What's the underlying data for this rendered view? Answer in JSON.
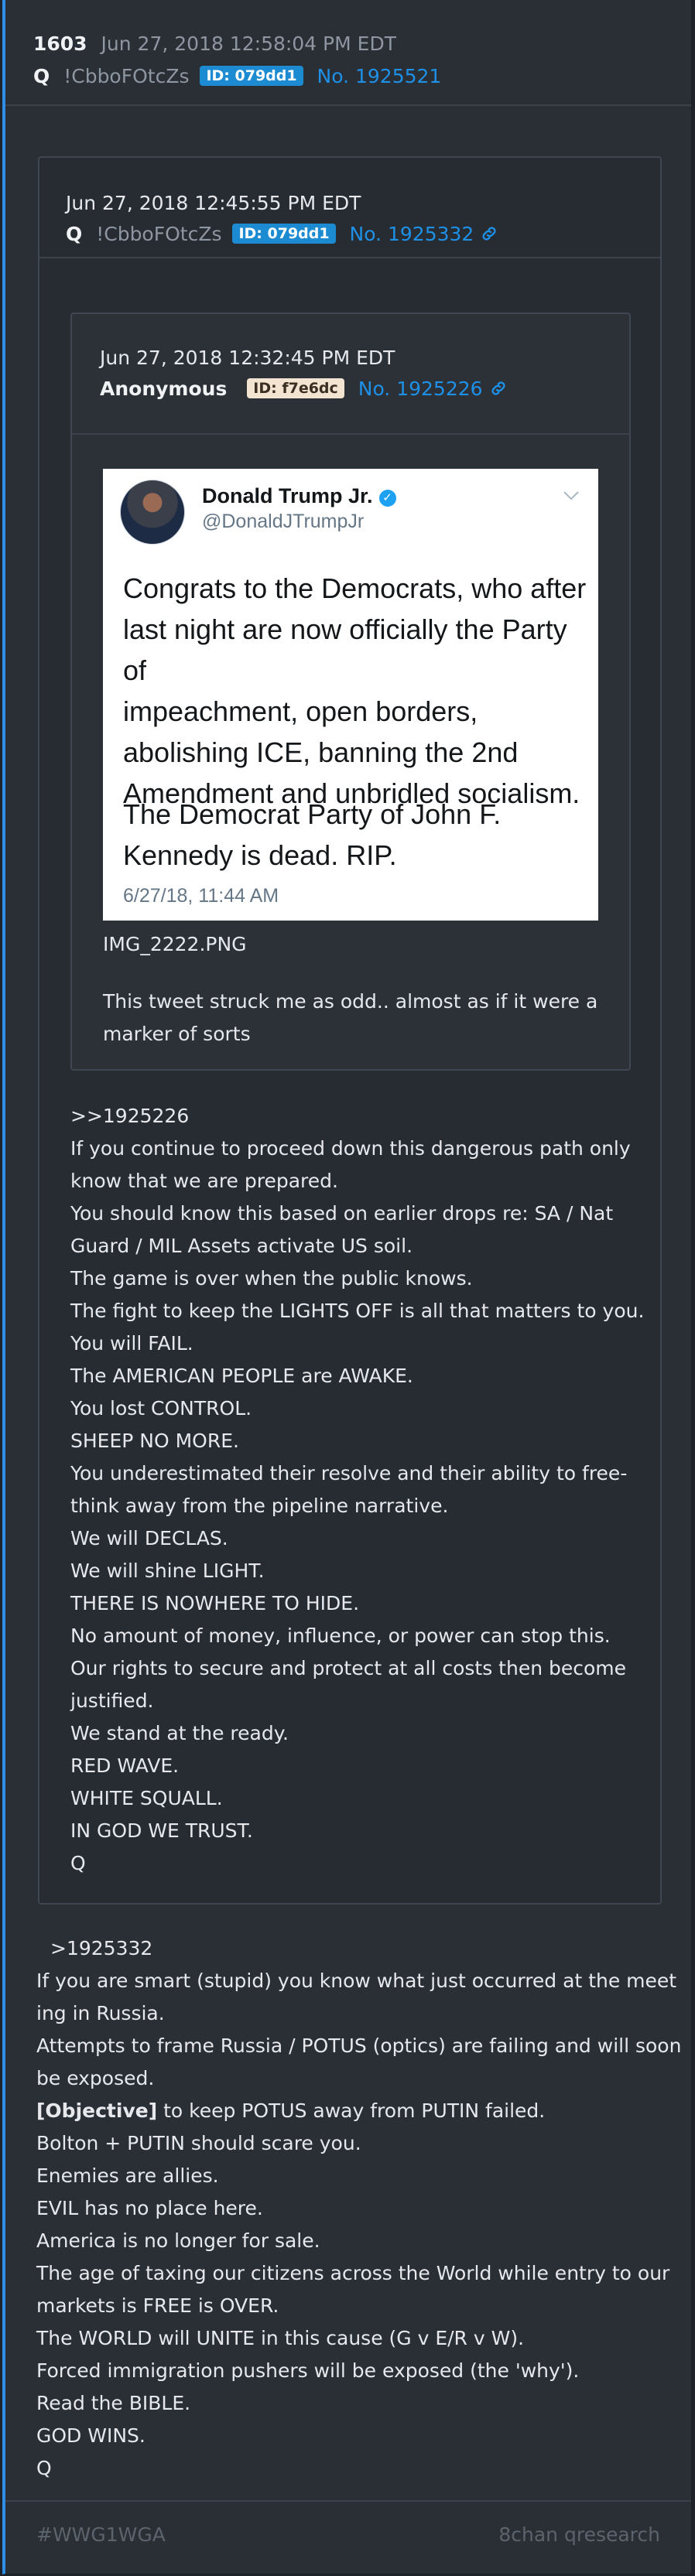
{
  "post": {
    "number": "1603",
    "timestamp": "Jun 27, 2018 12:58:04 PM EDT",
    "author": "Q",
    "tripcode": "!CbboFOtcZs",
    "id_badge": "ID: 079dd1",
    "post_no": "No. 1925521"
  },
  "quote1": {
    "timestamp": "Jun 27, 2018 12:45:55 PM EDT",
    "author": "Q",
    "tripcode": "!CbboFOtcZs",
    "id_badge": "ID: 079dd1",
    "post_no": "No. 1925332"
  },
  "quote2": {
    "timestamp": "Jun 27, 2018 12:32:45 PM EDT",
    "author": "Anonymous",
    "id_badge": "ID: f7e6dc",
    "post_no": "No. 1925226",
    "image_filename": "IMG_2222.PNG",
    "lines": [
      "This tweet struck me as odd.. almost as if it were a",
      "marker of sorts"
    ]
  },
  "tweet": {
    "name": "Donald Trump Jr.",
    "handle": "@DonaldJTrumpJr",
    "para1": [
      "Congrats to the Democrats, who after",
      "last night are now officially the Party of",
      "impeachment, open borders,",
      "abolishing ICE, banning the 2nd",
      "Amendment and unbridled socialism."
    ],
    "para2": [
      "The Democrat Party of John F.",
      "Kennedy is dead. RIP."
    ],
    "date": "6/27/18, 11:44 AM"
  },
  "quote1_body": [
    ">>1925226",
    "If you continue to proceed down this dangerous path only",
    "know that we are prepared.",
    "You should know this based on earlier drops re: SA / Nat",
    "Guard / MIL Assets activate US soil.",
    "The game is over when the public knows.",
    "The fight to keep the LIGHTS OFF is all that matters to you.",
    "You will FAIL.",
    "The AMERICAN PEOPLE are AWAKE.",
    "You lost CONTROL.",
    "SHEEP NO MORE.",
    "You underestimated their resolve and their ability to free-",
    "think away from the pipeline narrative.",
    "We will DECLAS.",
    "We will shine LIGHT.",
    "THERE IS NOWHERE TO HIDE.",
    "No amount of money, influence, or power can stop this.",
    "Our rights to secure and protect at all costs then become",
    "justified.",
    "We stand at the ready.",
    "RED WAVE.",
    "WHITE SQUALL.",
    "IN GOD WE TRUST.",
    "Q"
  ],
  "main_body": {
    "quote_ref": ">1925332",
    "lines_before": [
      "If you are smart (stupid) you know what just occurred at the meet",
      "ing in Russia.",
      "Attempts to frame Russia / POTUS (optics) are failing and will soon",
      "be exposed."
    ],
    "objective_bold": "[Objective]",
    "objective_rest": " to keep POTUS away from PUTIN failed.",
    "lines_after": [
      "Bolton + PUTIN should scare you.",
      "Enemies are allies.",
      "EVIL has no place here.",
      "America is no longer for sale.",
      "The age of taxing our citizens across the World while entry to our",
      "markets is FREE is OVER.",
      "The WORLD will UNITE in this cause (G v E/R v W).",
      "Forced immigration pushers will be exposed (the 'why').",
      "Read the BIBLE.",
      "GOD WINS.",
      "Q"
    ]
  },
  "footer": {
    "hashtag": "#WWG1WGA",
    "source": "8chan qresearch"
  },
  "colors": {
    "accent": "#2f8fe6",
    "link": "#1e90e6",
    "id_blue": "#1d8bd1",
    "id_beige": "#f3e4d2"
  }
}
